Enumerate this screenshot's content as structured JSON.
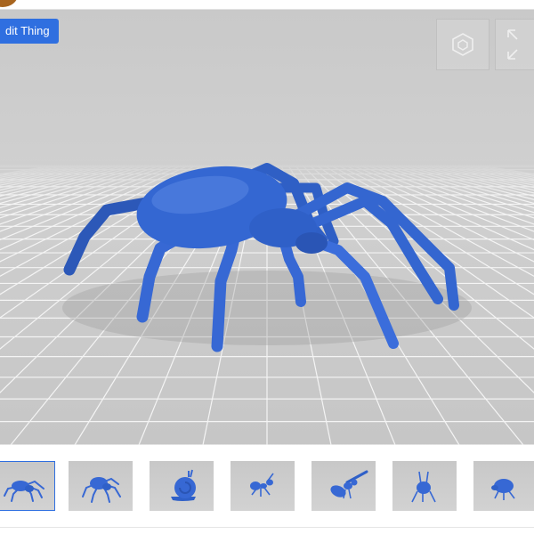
{
  "header": {
    "edit_button_label": "dit Thing"
  },
  "viewer": {
    "model_color": "#3768d4",
    "controls": [
      {
        "name": "3d-view",
        "icon": "cube-icon"
      },
      {
        "name": "fullscreen",
        "icon": "expand-icon"
      }
    ]
  },
  "thumbnails": [
    {
      "subject": "spider",
      "icon": "spider-icon",
      "selected": true
    },
    {
      "subject": "spider",
      "icon": "spider-icon",
      "selected": false
    },
    {
      "subject": "snail",
      "icon": "snail-icon",
      "selected": false
    },
    {
      "subject": "ant",
      "icon": "ant-icon",
      "selected": false
    },
    {
      "subject": "wasp",
      "icon": "wasp-icon",
      "selected": false
    },
    {
      "subject": "grasshopper",
      "icon": "grasshopper-icon",
      "selected": false
    },
    {
      "subject": "beetle",
      "icon": "beetle-icon",
      "selected": false
    }
  ]
}
